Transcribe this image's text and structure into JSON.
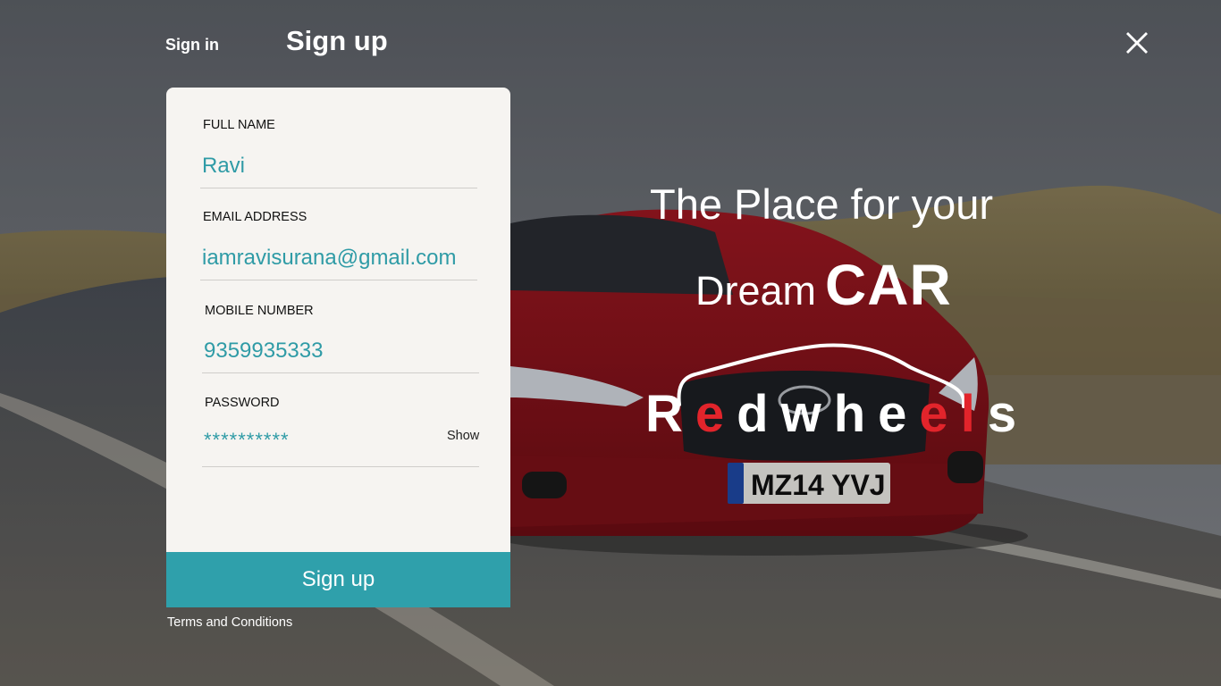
{
  "tabs": {
    "signin_label": "Sign in",
    "signup_label": "Sign up"
  },
  "form": {
    "full_name": {
      "label": "FULL NAME",
      "value": "Ravi"
    },
    "email": {
      "label": "EMAIL ADDRESS",
      "value": "iamravisurana@gmail.com"
    },
    "mobile": {
      "label": "MOBILE NUMBER",
      "value": "9359935333"
    },
    "password": {
      "label": "PASSWORD",
      "value": "**********",
      "toggle_label": "Show"
    },
    "submit_label": "Sign up",
    "terms_label": "Terms and Conditions"
  },
  "hero": {
    "line1": "The Place for your",
    "line2_prefix": "Dream",
    "line2_emphasis": "CAR",
    "logo_text": "Redwheels",
    "plate": "MZ14 YVJ"
  },
  "colors": {
    "accent": "#2fa0ab",
    "input_text": "#2f9ba6",
    "logo_red": "#e2242b",
    "card_bg": "#f6f4f1"
  },
  "icons": {
    "close": "close-icon",
    "logo_car_outline": "car-outline-icon"
  }
}
